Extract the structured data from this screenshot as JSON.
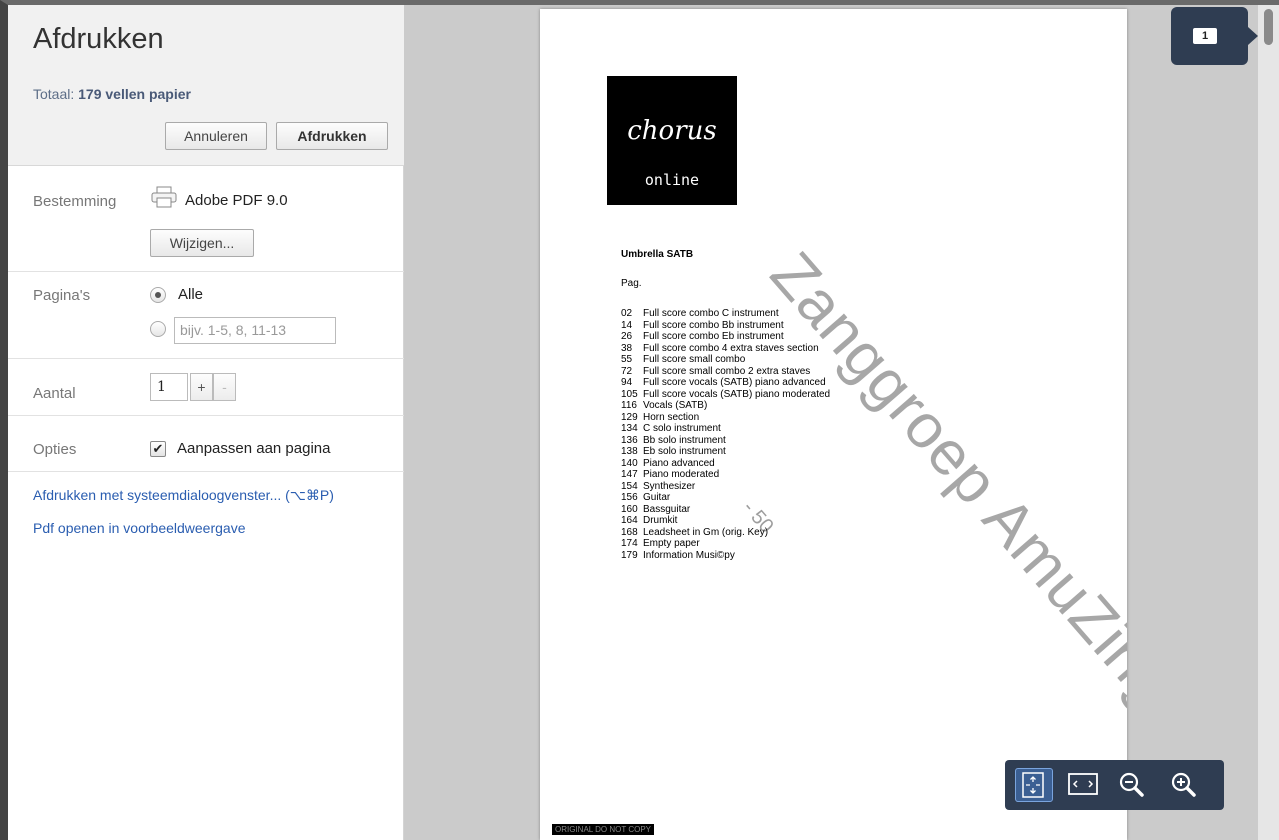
{
  "sidebar": {
    "title": "Afdrukken",
    "total_prefix": "Totaal: ",
    "total_value": "179 vellen papier",
    "cancel_label": "Annuleren",
    "print_label": "Afdrukken",
    "destination": {
      "label": "Bestemming",
      "printer_name": "Adobe PDF 9.0",
      "change_label": "Wijzigen..."
    },
    "pages": {
      "label": "Pagina's",
      "all_label": "Alle",
      "range_placeholder": "bijv. 1-5, 8, 11-13"
    },
    "copies": {
      "label": "Aantal",
      "value": "1",
      "plus": "+",
      "minus": "-"
    },
    "options": {
      "label": "Opties",
      "fit_label": "Aanpassen aan pagina",
      "fit_checked": true
    },
    "links": {
      "system_dialog": "Afdrukken met systeemdialoogvenster... (⌥⌘P)",
      "open_pdf": "Pdf openen in voorbeeldweergave"
    }
  },
  "preview": {
    "page_number": "1",
    "document": {
      "logo_word": "chorus",
      "logo_sub": "online",
      "title": "Umbrella SATB",
      "pag_label": "Pag.",
      "toc": [
        {
          "num": "02",
          "text": "Full score combo C  instrument"
        },
        {
          "num": "14",
          "text": "Full score combo Bb instrument"
        },
        {
          "num": "26",
          "text": "Full score combo Eb instrument"
        },
        {
          "num": "38",
          "text": "Full score combo 4 extra staves section"
        },
        {
          "num": "55",
          "text": "Full score small combo"
        },
        {
          "num": "72",
          "text": "Full score small combo 2 extra staves"
        },
        {
          "num": "94",
          "text": "Full score vocals (SATB) piano advanced"
        },
        {
          "num": "105",
          "text": "Full score vocals (SATB) piano moderated"
        },
        {
          "num": "116",
          "text": "Vocals (SATB)"
        },
        {
          "num": "129",
          "text": "Horn section"
        },
        {
          "num": "134",
          "text": "C solo instrument"
        },
        {
          "num": "136",
          "text": "Bb solo instrument"
        },
        {
          "num": "138",
          "text": "Eb solo instrument"
        },
        {
          "num": "140",
          "text": "Piano advanced"
        },
        {
          "num": "147",
          "text": "Piano moderated"
        },
        {
          "num": "154",
          "text": "Synthesizer"
        },
        {
          "num": "156",
          "text": "Guitar"
        },
        {
          "num": "160",
          "text": "Bassguitar"
        },
        {
          "num": "164",
          "text": "Drumkit"
        },
        {
          "num": "168",
          "text": "Leadsheet in Gm (orig. Key)"
        },
        {
          "num": "174",
          "text": "Empty paper"
        },
        {
          "num": "179",
          "text": "Information Musi©py"
        }
      ],
      "watermark": "Zanggroep AmuZing",
      "watermark_sub": "- 50",
      "footer": "ORIGINAL DO NOT COPY"
    },
    "zoom_controls": [
      "fit-page-icon",
      "fit-width-icon",
      "zoom-out-icon",
      "zoom-in-icon"
    ]
  },
  "colors": {
    "accent_link": "#2a5db0",
    "badge_bg": "#2f3d52",
    "preview_bg": "#cbcbcb"
  }
}
